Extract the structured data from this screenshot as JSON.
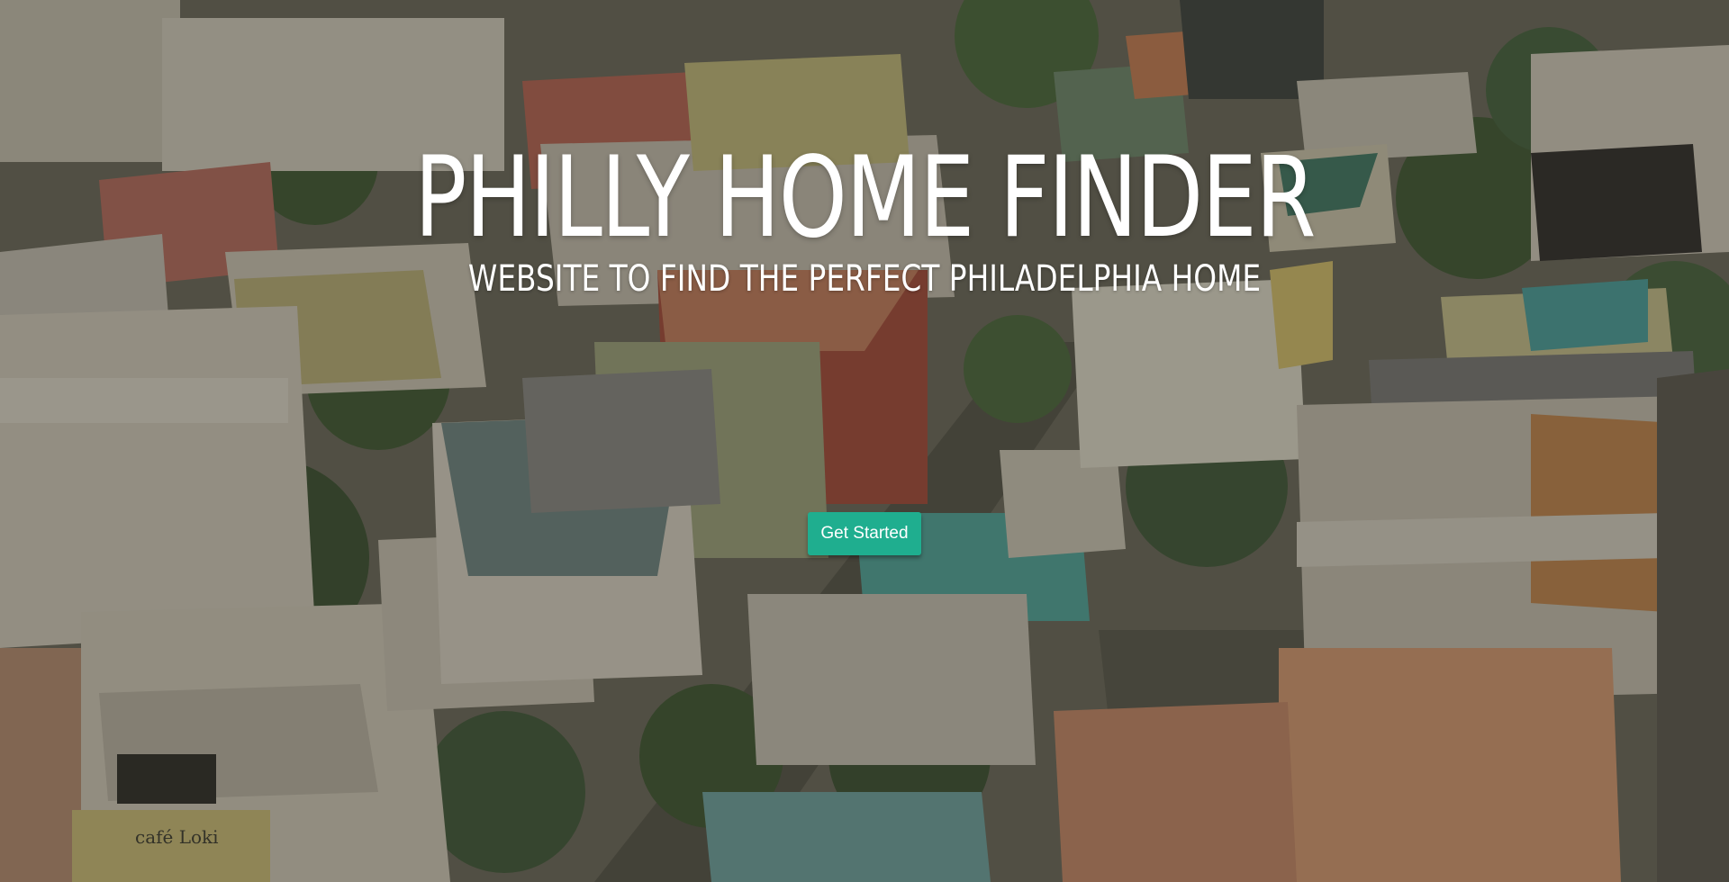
{
  "hero": {
    "title": "PHILLY HOME FINDER",
    "subtitle": "WEBSITE TO FIND THE PERFECT PHILADELPHIA HOME",
    "cta_label": "Get Started",
    "background_image": "aerial-town-rooftops-photo",
    "cafe_sign": "café Loki"
  },
  "colors": {
    "cta_background": "#1fae8f",
    "text": "#ffffff",
    "overlay": "rgba(40,38,30,0.38)"
  }
}
